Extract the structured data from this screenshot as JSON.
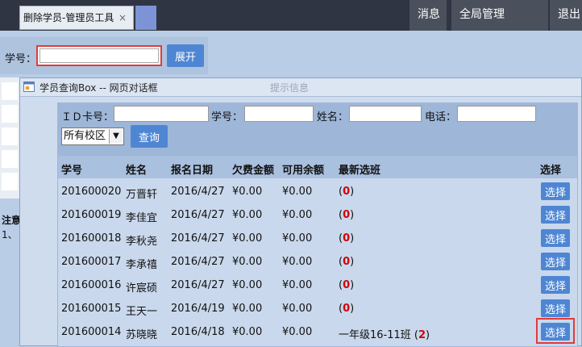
{
  "tab": {
    "label": "删除学员-管理员工具",
    "close": "×"
  },
  "nav": {
    "messages": "消息",
    "global_admin": "全局管理",
    "exit": "退出"
  },
  "search": {
    "label": "学号：",
    "value": "",
    "expand_button": "展开"
  },
  "notes": {
    "line1": "注意",
    "line2": "1、"
  },
  "dialog": {
    "title": "学员查询Box -- 网页对话框",
    "center_title": "提示信息",
    "form": {
      "id_card_label": "ＩＤ卡号：",
      "student_no_label": "学号：",
      "name_label": "姓名：",
      "phone_label": "电话：",
      "campus_selected": "所有校区",
      "query_button": "查询"
    },
    "table": {
      "headers": [
        "学号",
        "姓名",
        "报名日期",
        "欠费金额",
        "可用余额",
        "最新选班",
        "选择"
      ],
      "rows": [
        {
          "id": "201600020",
          "name": "万晋轩",
          "date": "2016/4/27",
          "owed": "¥0.00",
          "balance": "¥0.00",
          "cls_prefix": "(",
          "cls_count": "0",
          "cls_suffix": ")",
          "btn": "选择"
        },
        {
          "id": "201600019",
          "name": "李佳宜",
          "date": "2016/4/27",
          "owed": "¥0.00",
          "balance": "¥0.00",
          "cls_prefix": "(",
          "cls_count": "0",
          "cls_suffix": ")",
          "btn": "选择"
        },
        {
          "id": "201600018",
          "name": "李秋尧",
          "date": "2016/4/27",
          "owed": "¥0.00",
          "balance": "¥0.00",
          "cls_prefix": "(",
          "cls_count": "0",
          "cls_suffix": ")",
          "btn": "选择"
        },
        {
          "id": "201600017",
          "name": "李承禧",
          "date": "2016/4/27",
          "owed": "¥0.00",
          "balance": "¥0.00",
          "cls_prefix": "(",
          "cls_count": "0",
          "cls_suffix": ")",
          "btn": "选择"
        },
        {
          "id": "201600016",
          "name": "许宸硕",
          "date": "2016/4/27",
          "owed": "¥0.00",
          "balance": "¥0.00",
          "cls_prefix": "(",
          "cls_count": "0",
          "cls_suffix": ")",
          "btn": "选择"
        },
        {
          "id": "201600015",
          "name": "王天一",
          "date": "2016/4/19",
          "owed": "¥0.00",
          "balance": "¥0.00",
          "cls_prefix": "(",
          "cls_count": "0",
          "cls_suffix": ")",
          "btn": "选择"
        },
        {
          "id": "201600014",
          "name": "苏晓晓",
          "date": "2016/4/18",
          "owed": "¥0.00",
          "balance": "¥0.00",
          "cls_prefix": "一年级16-11班 (",
          "cls_count": "2",
          "cls_suffix": ")",
          "btn": "选择"
        }
      ]
    }
  },
  "colors": {
    "accent": "#4e86d3",
    "highlight": "#e23a3a",
    "topbar": "#2f3542"
  }
}
